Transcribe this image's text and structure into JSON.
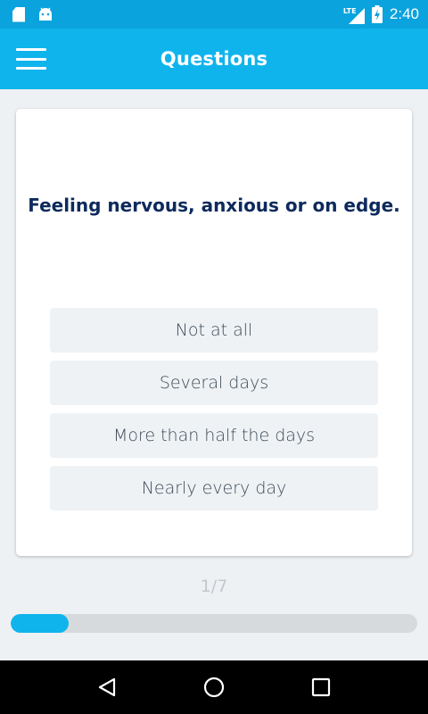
{
  "status_bar": {
    "time": "2:40",
    "network": "LTE",
    "icons": [
      "sd-card-icon",
      "android-icon",
      "signal-icon",
      "battery-charging-icon"
    ]
  },
  "app_bar": {
    "title": "Questions",
    "menu_icon": "hamburger-menu-icon"
  },
  "question": {
    "text": "Feeling nervous, anxious or on edge."
  },
  "options": [
    {
      "label": "Not at all"
    },
    {
      "label": "Several days"
    },
    {
      "label": "More than half the days"
    },
    {
      "label": "Nearly every day"
    }
  ],
  "progress": {
    "label": "1/7",
    "current": 1,
    "total": 7
  },
  "nav_bar": {
    "icons": [
      "back-icon",
      "home-icon",
      "recents-icon"
    ]
  },
  "colors": {
    "status_bar": "#0aa3dd",
    "app_bar": "#10b4ec",
    "question_text": "#0d2a5c",
    "option_bg": "#eef2f5",
    "progress_fill": "#10b4ec",
    "progress_track": "#d7dadd"
  }
}
